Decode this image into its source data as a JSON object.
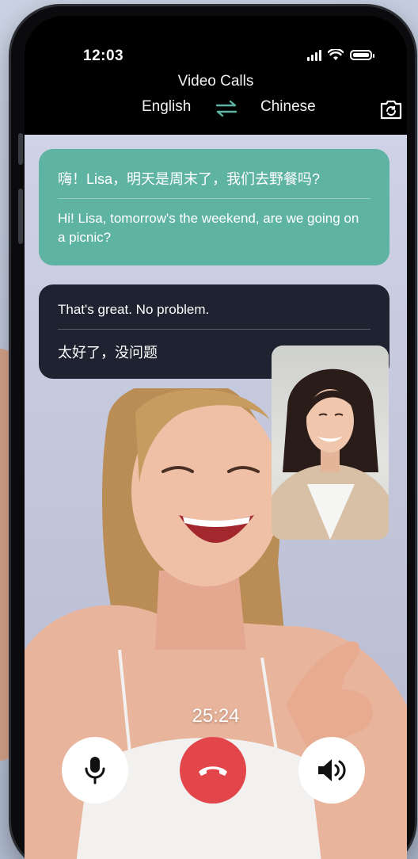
{
  "status": {
    "time": "12:03"
  },
  "header": {
    "title": "Video Calls",
    "source_language": "English",
    "target_language": "Chinese"
  },
  "messages": [
    {
      "original": "嗨！Lisa，明天是周末了，我们去野餐吗?",
      "translation": "Hi! Lisa, tomorrow's the weekend, are we going on a picnic?",
      "color": "#5fb3a3"
    },
    {
      "original": "That's great. No problem.",
      "translation": "太好了，没问题",
      "color": "#1f2230"
    }
  ],
  "call": {
    "duration": "25:24"
  },
  "controls": {
    "mic_icon": "microphone-icon",
    "end_icon": "hang-up-icon",
    "speaker_icon": "speaker-icon",
    "end_color": "#e2464b"
  },
  "icons": {
    "swap": "swap-arrows-icon",
    "camera": "camera-switch-icon"
  }
}
